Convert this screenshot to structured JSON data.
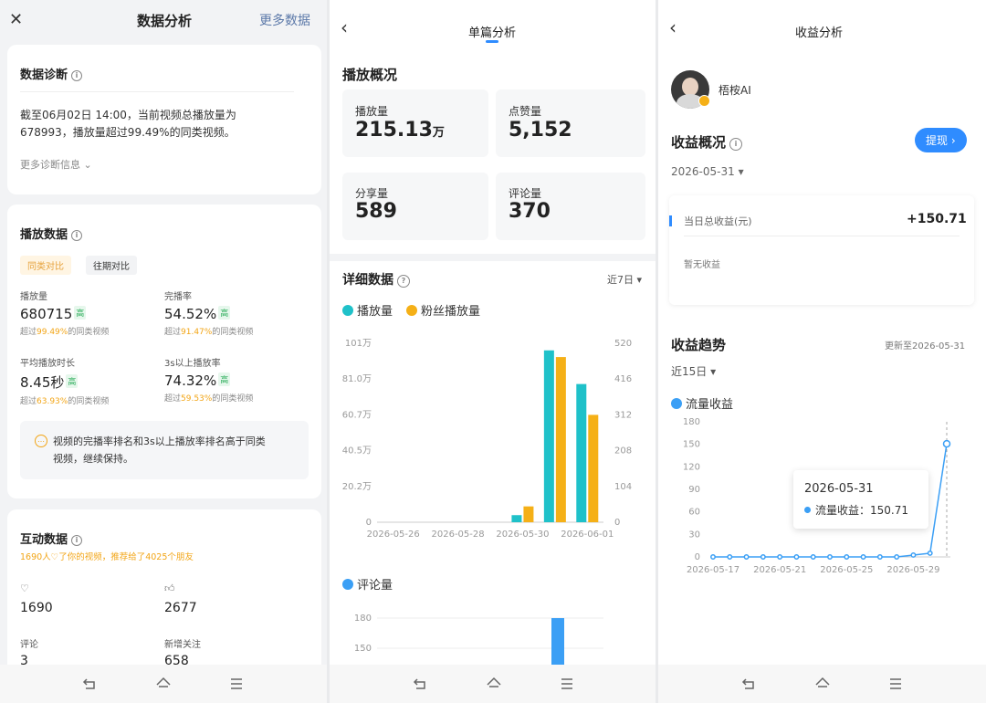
{
  "p1": {
    "title": "数据分析",
    "more": "更多数据",
    "diagnosis": {
      "title": "数据诊断",
      "text1": "截至06月02日 14:00，当前视频总播放量为",
      "text2": "678993，播放量超过99.49%的同类视频。",
      "more": "更多诊断信息"
    },
    "play": {
      "title": "播放数据",
      "tab1": "同类对比",
      "tab2": "往期对比",
      "metrics": [
        {
          "label": "播放量",
          "value": "680715",
          "badge": "高",
          "pre": "超过",
          "pct": "99.49%",
          "post": "的同类视频"
        },
        {
          "label": "完播率",
          "value": "54.52%",
          "badge": "高",
          "pre": "超过",
          "pct": "91.47%",
          "post": "的同类视频"
        },
        {
          "label": "平均播放时长",
          "value": "8.45秒",
          "badge": "高",
          "pre": "超过",
          "pct": "63.93%",
          "post": "的同类视频"
        },
        {
          "label": "3s以上播放率",
          "value": "74.32%",
          "badge": "高",
          "pre": "超过",
          "pct": "59.53%",
          "post": "的同类视频"
        }
      ],
      "tip1": "视频的完播率排名和3s以上播放率排名高于同类",
      "tip2": "视频，继续保持。"
    },
    "interact": {
      "title": "互动数据",
      "sub": "1690人♡了你的视频，推荐给了4025个朋友",
      "likes": "1690",
      "thumbs": "2677",
      "comment_label": "评论",
      "comment_value": "3",
      "follow_label": "新增关注",
      "follow_value": "658"
    }
  },
  "p2": {
    "title": "单篇分析",
    "overview": "播放概况",
    "cards": [
      {
        "label": "播放量",
        "value": "215.13",
        "unit": "万"
      },
      {
        "label": "点赞量",
        "value": "5,152",
        "unit": ""
      },
      {
        "label": "分享量",
        "value": "589",
        "unit": ""
      },
      {
        "label": "评论量",
        "value": "370",
        "unit": ""
      }
    ],
    "detail": "详细数据",
    "range": "近7日",
    "legend1": "播放量",
    "legend2": "粉丝播放量",
    "legend3": "评论量"
  },
  "p3": {
    "title": "收益分析",
    "user": "梧桉AI",
    "overview": "收益概况",
    "withdraw": "提现",
    "date": "2026-05-31",
    "today_label": "当日总收益(元)",
    "today_value": "+150.71",
    "no_income": "暂无收益",
    "trend": "收益趋势",
    "updated": "更新至2026-05-31",
    "range": "近15日",
    "legend": "流量收益",
    "tooltip_date": "2026-05-31",
    "tooltip_label": "流量收益：150.71"
  },
  "chart_data": [
    {
      "type": "bar",
      "categories": [
        "2026-05-26",
        "2026-05-27",
        "2026-05-28",
        "2026-05-29",
        "2026-05-30",
        "2026-05-31",
        "2026-06-01"
      ],
      "x_tick_labels": [
        "2026-05-26",
        "2026-05-28",
        "2026-05-30",
        "2026-06-01"
      ],
      "series": [
        {
          "name": "播放量",
          "axis": "left",
          "color": "#1fc1c9",
          "values": [
            0,
            0,
            0,
            0,
            4,
            97,
            78
          ]
        },
        {
          "name": "粉丝播放量",
          "axis": "right",
          "color": "#f5b017",
          "values": [
            0,
            0,
            0,
            0,
            46,
            480,
            312
          ]
        }
      ],
      "yticks_left": [
        "0",
        "20.2万",
        "40.5万",
        "60.7万",
        "81.0万",
        "101万"
      ],
      "yticks_right": [
        "0",
        "104",
        "208",
        "312",
        "416",
        "520"
      ],
      "ylim_left": [
        0,
        101
      ],
      "ylim_right": [
        0,
        520
      ]
    },
    {
      "type": "bar",
      "series": [
        {
          "name": "评论量",
          "color": "#3b9ff5",
          "values": [
            180
          ]
        }
      ],
      "yticks": [
        "180",
        "150"
      ]
    },
    {
      "type": "line",
      "x": [
        "2026-05-17",
        "2026-05-18",
        "2026-05-19",
        "2026-05-20",
        "2026-05-21",
        "2026-05-22",
        "2026-05-23",
        "2026-05-24",
        "2026-05-25",
        "2026-05-26",
        "2026-05-27",
        "2026-05-28",
        "2026-05-29",
        "2026-05-30",
        "2026-05-31"
      ],
      "x_tick_labels": [
        "2026-05-17",
        "2026-05-21",
        "2026-05-25",
        "2026-05-29"
      ],
      "series": [
        {
          "name": "流量收益",
          "color": "#3b9ff5",
          "values": [
            0,
            0,
            0,
            0,
            0,
            0,
            0,
            0,
            0,
            0,
            0,
            0,
            2.5,
            5,
            150.71
          ]
        }
      ],
      "yticks": [
        "0",
        "30",
        "60",
        "90",
        "120",
        "150",
        "180"
      ],
      "ylim": [
        0,
        180
      ]
    }
  ]
}
